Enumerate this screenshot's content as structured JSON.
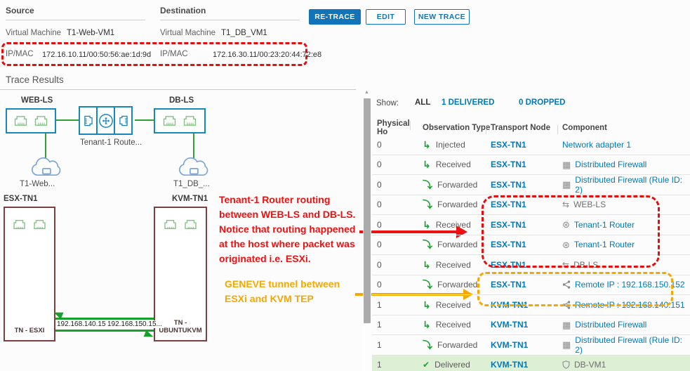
{
  "header": {
    "source": {
      "title": "Source",
      "vm_label": "Virtual Machine",
      "vm_value": "T1-Web-VM1",
      "ipmac_label": "IP/MAC",
      "ipmac_value": "172.16.10.11/00:50:56:ae:1d:9d"
    },
    "destination": {
      "title": "Destination",
      "vm_label": "Virtual Machine",
      "vm_value": "T1_DB_VM1",
      "ipmac_label": "IP/MAC",
      "ipmac_value": "172.16.30.11/00:23:20:44:72:e8"
    },
    "buttons": {
      "retrace": "RE-TRACE",
      "edit": "EDIT",
      "new_trace": "NEW TRACE"
    }
  },
  "section_title": "Trace Results",
  "topology": {
    "web_ls_label": "WEB-LS",
    "db_ls_label": "DB-LS",
    "router_label": "Tenant-1 Route...",
    "web_vm_label": "T1-Web...",
    "db_vm_label": "T1_DB_...",
    "esx_title": "ESX-TN1",
    "kvm_title": "KVM-TN1",
    "esx_name": "TN - ESXI",
    "kvm_name": "TN - UBUNTUKVM",
    "tunnel_ip_left": "192.168.140.15...",
    "tunnel_ip_right": "192.168.150.15..."
  },
  "annotations": {
    "red_note": "Tenant-1 Router routing\nbetween WEB-LS and DB-LS.\nNotice that routing happened\nat the host where packet was\noriginated i.e. ESXi.",
    "orange_note": "GENEVE tunnel between\nESXi and KVM TEP"
  },
  "table": {
    "show_label": "Show:",
    "filters": {
      "all": "ALL",
      "delivered": "1 DELIVERED",
      "dropped": "0 DROPPED"
    },
    "columns": [
      "Physical Ho",
      "Observation Type",
      "Transport Node",
      "Component"
    ],
    "rows": [
      {
        "hop": "0",
        "observation": "Injected",
        "obs_icon": "injected-icon",
        "node": "ESX-TN1",
        "component": "Network adapter 1",
        "comp_icon": "",
        "comp_link": true,
        "highlight": false
      },
      {
        "hop": "0",
        "observation": "Received",
        "obs_icon": "received-icon",
        "node": "ESX-TN1",
        "component": "Distributed Firewall",
        "comp_icon": "firewall-icon",
        "comp_link": true,
        "highlight": false
      },
      {
        "hop": "0",
        "observation": "Forwarded",
        "obs_icon": "forwarded-icon",
        "node": "ESX-TN1",
        "component": "Distributed Firewall (Rule ID: 2)",
        "comp_icon": "firewall-icon",
        "comp_link": true,
        "highlight": false
      },
      {
        "hop": "0",
        "observation": "Forwarded",
        "obs_icon": "forwarded-icon",
        "node": "ESX-TN1",
        "component": "WEB-LS",
        "comp_icon": "switch-icon",
        "comp_link": false,
        "highlight": false
      },
      {
        "hop": "0",
        "observation": "Received",
        "obs_icon": "received-icon",
        "node": "ESX-TN1",
        "component": "Tenant-1 Router",
        "comp_icon": "router-icon",
        "comp_link": true,
        "highlight": false
      },
      {
        "hop": "0",
        "observation": "Forwarded",
        "obs_icon": "forwarded-icon",
        "node": "ESX-TN1",
        "component": "Tenant-1 Router",
        "comp_icon": "router-icon",
        "comp_link": true,
        "highlight": false
      },
      {
        "hop": "0",
        "observation": "Received",
        "obs_icon": "received-icon",
        "node": "ESX-TN1",
        "component": "DB-LS",
        "comp_icon": "switch-icon",
        "comp_link": false,
        "highlight": false
      },
      {
        "hop": "0",
        "observation": "Forwarded",
        "obs_icon": "forwarded-icon",
        "node": "ESX-TN1",
        "component": "Remote IP : 192.168.150.152",
        "comp_icon": "share-icon",
        "comp_link": true,
        "highlight": false
      },
      {
        "hop": "1",
        "observation": "Received",
        "obs_icon": "received-icon",
        "node": "KVM-TN1",
        "component": "Remote IP : 192.168.140.151",
        "comp_icon": "share-icon",
        "comp_link": true,
        "highlight": false
      },
      {
        "hop": "1",
        "observation": "Received",
        "obs_icon": "received-icon",
        "node": "KVM-TN1",
        "component": "Distributed Firewall",
        "comp_icon": "firewall-icon",
        "comp_link": true,
        "highlight": false
      },
      {
        "hop": "1",
        "observation": "Forwarded",
        "obs_icon": "forwarded-icon",
        "node": "KVM-TN1",
        "component": "Distributed Firewall (Rule ID: 2)",
        "comp_icon": "firewall-icon",
        "comp_link": true,
        "highlight": false
      },
      {
        "hop": "1",
        "observation": "Delivered",
        "obs_icon": "delivered-icon",
        "node": "KVM-TN1",
        "component": "DB-VM1",
        "comp_icon": "shield-icon",
        "comp_link": false,
        "highlight": true
      }
    ]
  },
  "colors": {
    "accent_blue": "#1174b8",
    "link_blue": "#0079b8",
    "diagram_blue": "#1a87b9",
    "diagram_green": "#2fa32f",
    "host_maroon": "#7d4040",
    "annotation_red": "#ee1111",
    "annotation_orange": "#f5a800",
    "delivered_row_bg": "#ddefd5"
  }
}
